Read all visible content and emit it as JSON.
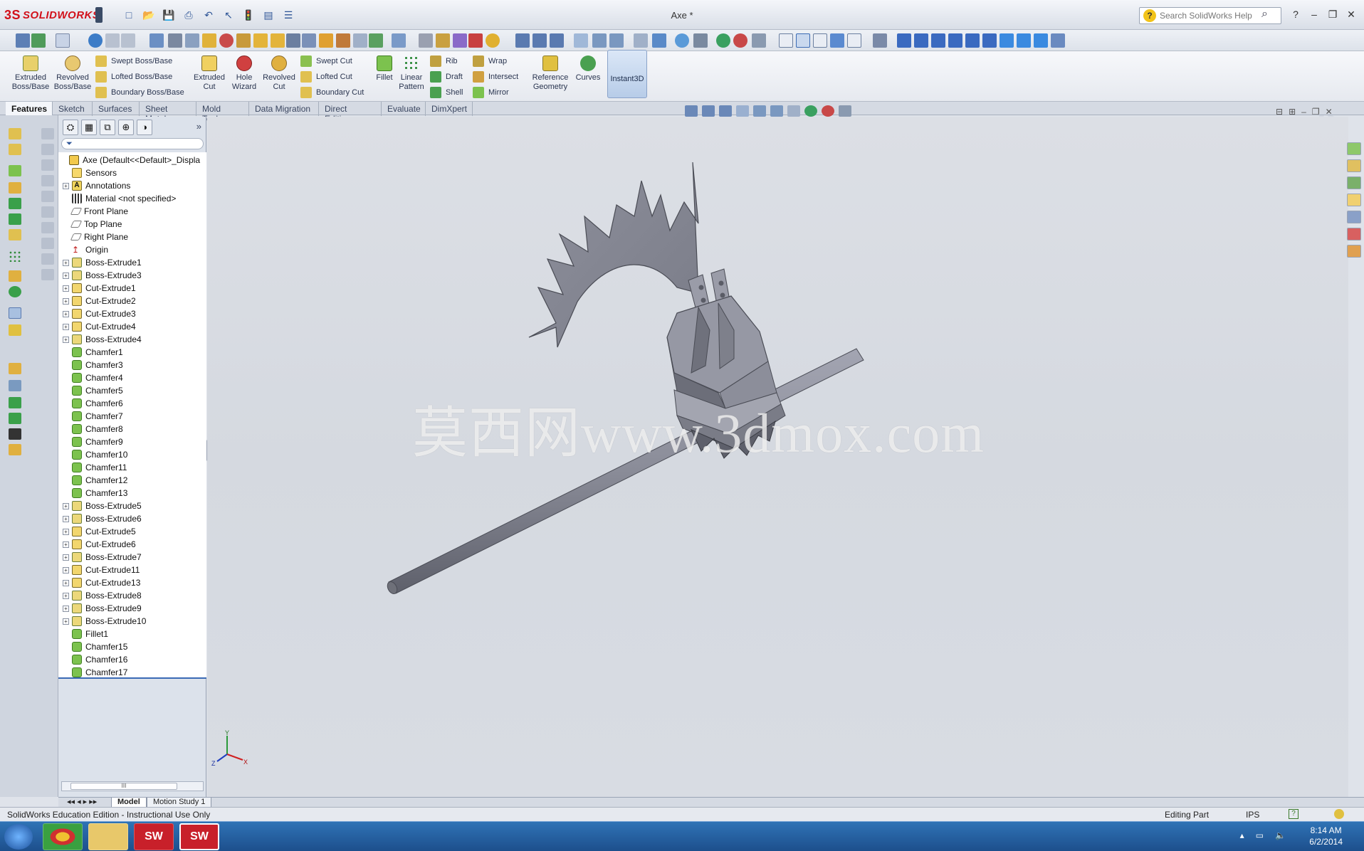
{
  "app": {
    "logo_text": "SOLIDWORKS",
    "logo_mark": "3S",
    "document_title": "Axe *",
    "search_placeholder": "Search SolidWorks Help"
  },
  "command_manager": {
    "big_buttons": [
      {
        "label": "Extruded Boss/Base"
      },
      {
        "label": "Revolved Boss/Base"
      },
      {
        "label": "Extruded Cut"
      },
      {
        "label": "Hole Wizard"
      },
      {
        "label": "Revolved Cut"
      },
      {
        "label": "Fillet"
      },
      {
        "label": "Linear Pattern"
      },
      {
        "label": "Reference Geometry"
      },
      {
        "label": "Curves"
      }
    ],
    "small_buttons": [
      {
        "label": "Swept Boss/Base"
      },
      {
        "label": "Lofted Boss/Base"
      },
      {
        "label": "Boundary Boss/Base"
      },
      {
        "label": "Swept Cut"
      },
      {
        "label": "Lofted Cut"
      },
      {
        "label": "Boundary Cut"
      },
      {
        "label": "Rib"
      },
      {
        "label": "Draft"
      },
      {
        "label": "Shell"
      },
      {
        "label": "Wrap"
      },
      {
        "label": "Intersect"
      },
      {
        "label": "Mirror"
      }
    ],
    "instant3d_label": "Instant3D"
  },
  "tabs": [
    "Features",
    "Sketch",
    "Surfaces",
    "Sheet Metal",
    "Mold Tools",
    "Data Migration",
    "Direct Editing",
    "Evaluate",
    "DimXpert"
  ],
  "active_tab": "Features",
  "feature_tree": {
    "root": "Axe  (Default<<Default>_Displa",
    "items": [
      {
        "label": "Sensors",
        "icon": "sensor",
        "expandable": false
      },
      {
        "label": "Annotations",
        "icon": "annotation",
        "expandable": true
      },
      {
        "label": "Material <not specified>",
        "icon": "material",
        "expandable": false
      },
      {
        "label": "Front Plane",
        "icon": "plane",
        "expandable": false
      },
      {
        "label": "Top Plane",
        "icon": "plane",
        "expandable": false
      },
      {
        "label": "Right Plane",
        "icon": "plane",
        "expandable": false
      },
      {
        "label": "Origin",
        "icon": "origin",
        "expandable": false
      },
      {
        "label": "Boss-Extrude1",
        "icon": "boss",
        "expandable": true
      },
      {
        "label": "Boss-Extrude3",
        "icon": "boss",
        "expandable": true
      },
      {
        "label": "Cut-Extrude1",
        "icon": "cut",
        "expandable": true
      },
      {
        "label": "Cut-Extrude2",
        "icon": "cut",
        "expandable": true
      },
      {
        "label": "Cut-Extrude3",
        "icon": "cut",
        "expandable": true
      },
      {
        "label": "Cut-Extrude4",
        "icon": "cut",
        "expandable": true
      },
      {
        "label": "Boss-Extrude4",
        "icon": "boss",
        "expandable": true
      },
      {
        "label": "Chamfer1",
        "icon": "chamfer",
        "expandable": false
      },
      {
        "label": "Chamfer3",
        "icon": "chamfer",
        "expandable": false
      },
      {
        "label": "Chamfer4",
        "icon": "chamfer",
        "expandable": false
      },
      {
        "label": "Chamfer5",
        "icon": "chamfer",
        "expandable": false
      },
      {
        "label": "Chamfer6",
        "icon": "chamfer",
        "expandable": false
      },
      {
        "label": "Chamfer7",
        "icon": "chamfer",
        "expandable": false
      },
      {
        "label": "Chamfer8",
        "icon": "chamfer",
        "expandable": false
      },
      {
        "label": "Chamfer9",
        "icon": "chamfer",
        "expandable": false
      },
      {
        "label": "Chamfer10",
        "icon": "chamfer",
        "expandable": false
      },
      {
        "label": "Chamfer11",
        "icon": "chamfer",
        "expandable": false
      },
      {
        "label": "Chamfer12",
        "icon": "chamfer",
        "expandable": false
      },
      {
        "label": "Chamfer13",
        "icon": "chamfer",
        "expandable": false
      },
      {
        "label": "Boss-Extrude5",
        "icon": "boss",
        "expandable": true
      },
      {
        "label": "Boss-Extrude6",
        "icon": "boss",
        "expandable": true
      },
      {
        "label": "Cut-Extrude5",
        "icon": "cut",
        "expandable": true
      },
      {
        "label": "Cut-Extrude6",
        "icon": "cut",
        "expandable": true
      },
      {
        "label": "Boss-Extrude7",
        "icon": "boss",
        "expandable": true
      },
      {
        "label": "Cut-Extrude11",
        "icon": "cut",
        "expandable": true
      },
      {
        "label": "Cut-Extrude13",
        "icon": "cut",
        "expandable": true
      },
      {
        "label": "Boss-Extrude8",
        "icon": "boss",
        "expandable": true
      },
      {
        "label": "Boss-Extrude9",
        "icon": "boss",
        "expandable": true
      },
      {
        "label": "Boss-Extrude10",
        "icon": "boss",
        "expandable": true
      },
      {
        "label": "Fillet1",
        "icon": "chamfer",
        "expandable": false
      },
      {
        "label": "Chamfer15",
        "icon": "chamfer",
        "expandable": false
      },
      {
        "label": "Chamfer16",
        "icon": "chamfer",
        "expandable": false
      },
      {
        "label": "Chamfer17",
        "icon": "chamfer",
        "expandable": false
      }
    ]
  },
  "viewport": {
    "watermark_text": "莫西网www.3dmox.com",
    "triad": {
      "x": "X",
      "y": "Y",
      "z": "Z"
    },
    "model_color": "#8e909c"
  },
  "bottom_tabs": [
    "Model",
    "Motion Study 1"
  ],
  "status": {
    "left": "SolidWorks Education Edition - Instructional Use Only",
    "mode": "Editing Part",
    "units": "IPS",
    "help": "?"
  },
  "taskbar": {
    "time": "8:14 AM",
    "date": "6/2/2014",
    "apps": [
      "SW",
      "SW"
    ]
  }
}
